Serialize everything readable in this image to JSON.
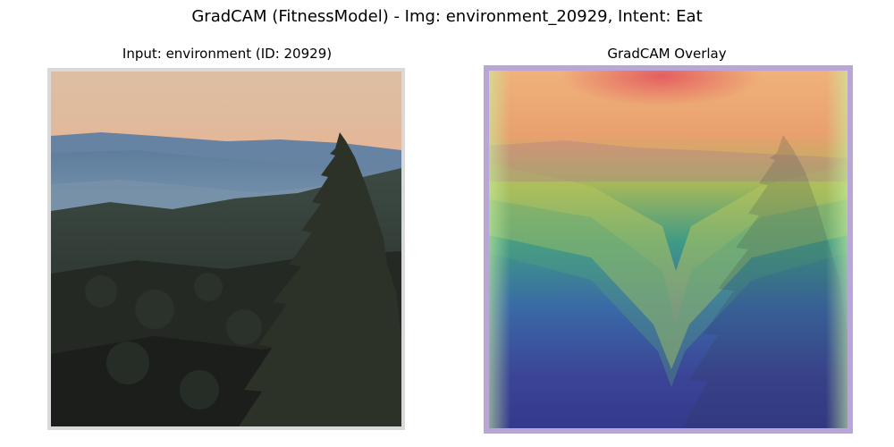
{
  "figure": {
    "title": "GradCAM (FitnessModel) - Img: environment_20929, Intent: Eat"
  },
  "panels": [
    {
      "title": "Input: environment (ID: 20929)",
      "image_content": "landscape photo: sunset sky, misty blue mountain ridges, dark forested hills with a tall conifer tree on the right"
    },
    {
      "title": "GradCAM Overlay",
      "image_content": "same landscape overlaid with a jet-colormap heatmap: red/orange at top center, yellow-green V-shape in the middle, blue at the bottom"
    }
  ],
  "colors": {
    "sky_top": "#dcb99c",
    "sky_bottom": "#f3a07a",
    "mountain_blue": "#6d8aa6",
    "forest_dark": "#2a2f28",
    "heat_high": "#e7525a",
    "heat_mid": "#a6c25a",
    "heat_low": "#3a3f9a"
  }
}
